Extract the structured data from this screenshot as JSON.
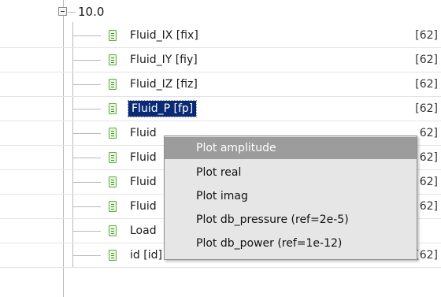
{
  "tree": {
    "root": {
      "label": "10.0"
    },
    "rows": [
      {
        "label": "Fluid_IX  [fix]",
        "value": "[62]"
      },
      {
        "label": "Fluid_IY  [fiy]",
        "value": "[62]"
      },
      {
        "label": "Fluid_IZ  [fiz]",
        "value": "[62]"
      },
      {
        "label": "Fluid_P  [fp]",
        "value": "[62]",
        "selected": true
      },
      {
        "label": "Fluid",
        "value": "62]"
      },
      {
        "label": "Fluid",
        "value": "62]"
      },
      {
        "label": "Fluid",
        "value": "62]"
      },
      {
        "label": "Fluid",
        "value": "62]"
      },
      {
        "label": "Load",
        "value": ""
      },
      {
        "label": "id  [id]",
        "value": "[62]"
      }
    ]
  },
  "context_menu": {
    "items": [
      {
        "label": "Plot amplitude",
        "highlighted": true
      },
      {
        "label": "Plot real"
      },
      {
        "label": "Plot imag"
      },
      {
        "label": "Plot db_pressure (ref=2e-5)"
      },
      {
        "label": "Plot db_power (ref=1e-12)"
      }
    ]
  },
  "colors": {
    "selection_bg": "#0a2a75",
    "menu_highlight": "#9c9c9c",
    "leaf_icon": "#5fae3d"
  }
}
